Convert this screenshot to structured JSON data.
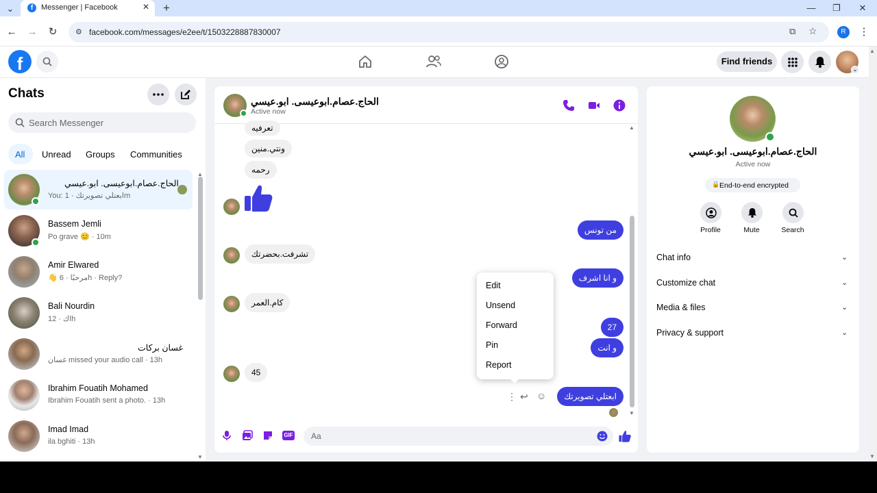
{
  "browser": {
    "tab_title": "Messenger | Facebook",
    "url": "facebook.com/messages/e2ee/t/1503228887830007",
    "profile_initial": "R"
  },
  "nav": {
    "find_friends": "Find friends"
  },
  "sidebar": {
    "title": "Chats",
    "search_placeholder": "Search Messenger",
    "filters": [
      "All",
      "Unread",
      "Groups",
      "Communities"
    ],
    "conversations": [
      {
        "name": "الحاج.عصام.ابوعيسى. ابو.عيسي",
        "preview": "You: ابعتلي تصويرتك · 1m"
      },
      {
        "name": "Bassem Jemli",
        "preview": "Po grave 😊 · 10m"
      },
      {
        "name": "Amir Elwared",
        "preview": "👋 مرحبًا · 6h · Reply?"
      },
      {
        "name": "Bali Nourdin",
        "preview": "اك · 12h"
      },
      {
        "name": "غسان بركات",
        "preview": "غسان missed your audio call · 13h"
      },
      {
        "name": "Ibrahim Fouatih Mohamed",
        "preview": "Ibrahim Fouatih sent a photo. · 13h"
      },
      {
        "name": "Imad Imad",
        "preview": "ila bghiti · 13h"
      }
    ]
  },
  "chat": {
    "name": "الحاج.عصام.ابوعيسى. ابو.عيسي",
    "status": "Active now",
    "messages_in": [
      "تعرفيه",
      "ونتي.منين",
      "رحمه",
      "تشرفت.بحضرتك",
      "كام.العمر",
      "45"
    ],
    "messages_out": [
      "من تونس",
      "و انا اشرف",
      "27",
      "و انت",
      "ابعتلي تصويرتك"
    ],
    "input_placeholder": "Aa"
  },
  "context_menu": [
    "Edit",
    "Unsend",
    "Forward",
    "Pin",
    "Report"
  ],
  "info_panel": {
    "name": "الحاج.عصام.ابوعيسى. ابو.عيسي",
    "status": "Active now",
    "encryption": "End-to-end encrypted",
    "actions": [
      "Profile",
      "Mute",
      "Search"
    ],
    "sections": [
      "Chat info",
      "Customize chat",
      "Media & files",
      "Privacy & support"
    ]
  },
  "colors": {
    "accent": "#3f3fe0",
    "fb_blue": "#1877f2",
    "online": "#31a24c"
  }
}
